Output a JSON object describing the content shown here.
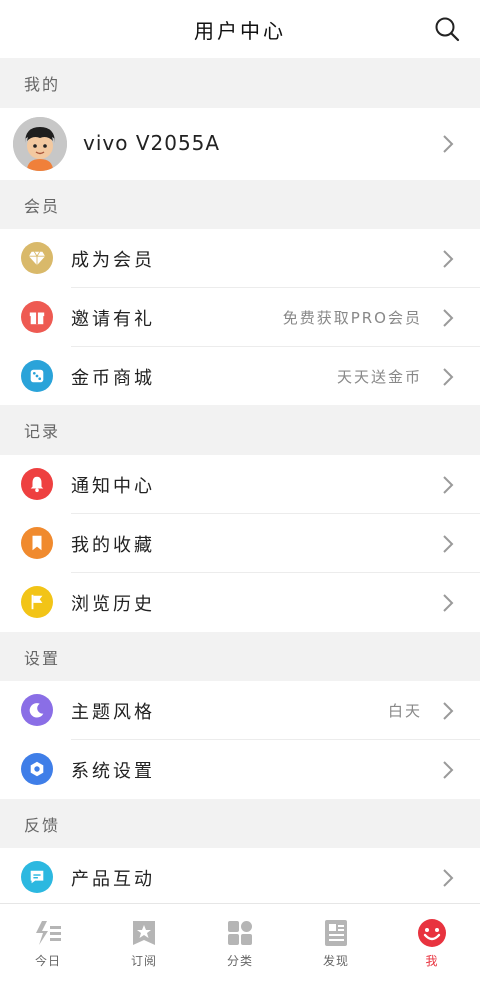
{
  "header": {
    "title": "用户中心",
    "search_icon": "search-icon"
  },
  "sections": {
    "mine": "我的",
    "member": "会员",
    "record": "记录",
    "settings": "设置",
    "feedback": "反馈"
  },
  "profile": {
    "name": "vivo V2055A",
    "avatar_icon": "avatar-icon"
  },
  "member_items": [
    {
      "label": "成为会员",
      "right": "",
      "icon": "diamond-icon",
      "color": "#d9b96a"
    },
    {
      "label": "邀请有礼",
      "right": "免费获取PRO会员",
      "icon": "gift-icon",
      "color": "#ee5a52"
    },
    {
      "label": "金币商城",
      "right": "天天送金币",
      "icon": "dice-icon",
      "color": "#2aa3d9"
    }
  ],
  "record_items": [
    {
      "label": "通知中心",
      "icon": "bell-icon",
      "color": "#ee4040"
    },
    {
      "label": "我的收藏",
      "icon": "bookmark-icon",
      "color": "#f08a2e"
    },
    {
      "label": "浏览历史",
      "icon": "flag-icon",
      "color": "#f2c417"
    }
  ],
  "settings_items": [
    {
      "label": "主题风格",
      "right": "白天",
      "icon": "moon-icon",
      "color": "#8a6ee6"
    },
    {
      "label": "系统设置",
      "right": "",
      "icon": "hexagon-gear-icon",
      "color": "#3f7ee8"
    }
  ],
  "feedback_items": [
    {
      "label": "产品互动",
      "icon": "message-icon",
      "color": "#2cb8e0"
    }
  ],
  "tabs": [
    {
      "label": "今日",
      "icon": "today-icon",
      "active": false
    },
    {
      "label": "订阅",
      "icon": "star-bookmark-icon",
      "active": false
    },
    {
      "label": "分类",
      "icon": "grid-icon",
      "active": false
    },
    {
      "label": "发现",
      "icon": "newspaper-icon",
      "active": false
    },
    {
      "label": "我",
      "icon": "smiley-icon",
      "active": true
    }
  ],
  "colors": {
    "accent": "#e8333f",
    "chevron": "#9a9a9a"
  }
}
